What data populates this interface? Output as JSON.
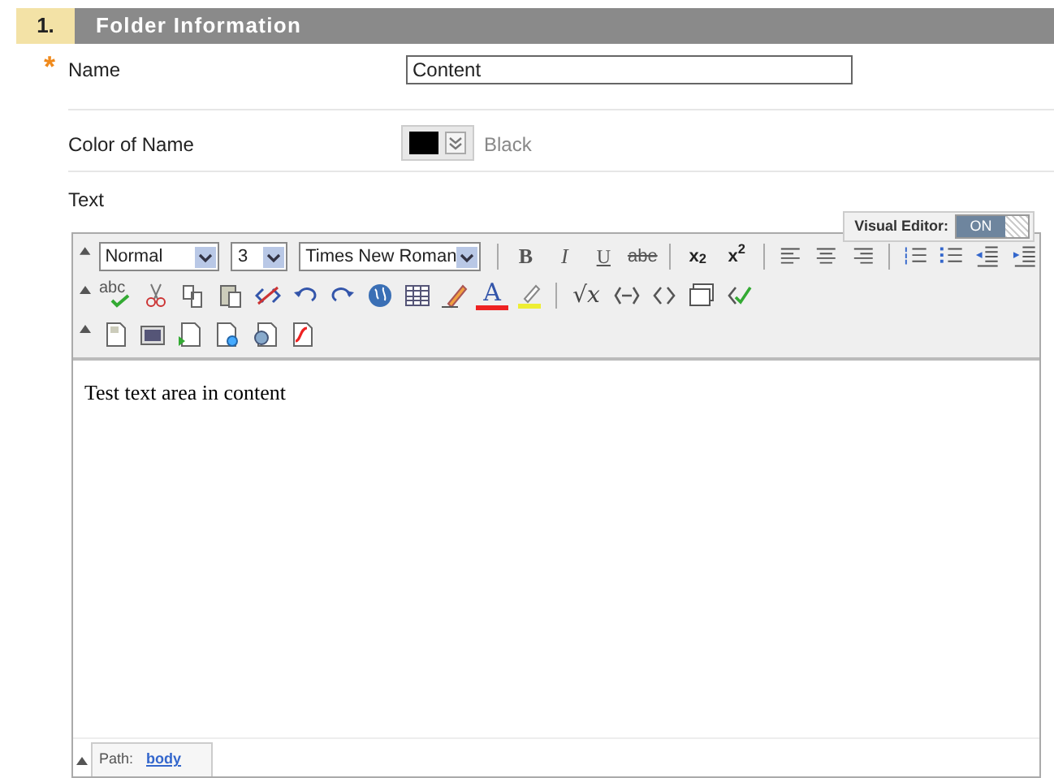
{
  "section": {
    "number": "1.",
    "title": "Folder Information"
  },
  "fields": [
    {
      "kind": "text",
      "label": "Name",
      "required_mark": "*",
      "value": "Content"
    },
    {
      "kind": "color",
      "label": "Color of Name",
      "color": "#000000",
      "color_name": "Black"
    }
  ],
  "text_label": "Text",
  "visual_editor": {
    "label": "Visual Editor:",
    "state": "ON",
    "on": true
  },
  "toolbar": [
    [
      {
        "kind": "select",
        "value": "Normal"
      },
      {
        "kind": "select",
        "value": "3"
      },
      {
        "kind": "select",
        "value": "Times New Roman"
      },
      {
        "kind": "sep"
      },
      {
        "kind": "text",
        "label": "B"
      },
      {
        "kind": "text",
        "label": "I"
      },
      {
        "kind": "text",
        "label": "U"
      },
      {
        "kind": "text",
        "label": "abe"
      },
      {
        "kind": "sep"
      },
      {
        "kind": "text",
        "label": "x$_{2}$"
      },
      {
        "kind": "text",
        "label": "x$^{2}$"
      },
      {
        "kind": "sep"
      },
      {
        "kind": "icon"
      },
      {
        "kind": "icon"
      },
      {
        "kind": "icon"
      },
      {
        "kind": "sep"
      },
      {
        "kind": "icon"
      },
      {
        "kind": "icon"
      },
      {
        "kind": "icon"
      },
      {
        "kind": "icon"
      }
    ],
    [
      {
        "kind": "spell",
        "label": "abc"
      },
      {
        "kind": "icon"
      },
      {
        "kind": "icon"
      },
      {
        "kind": "icon"
      },
      {
        "kind": "icon"
      },
      {
        "kind": "icon"
      },
      {
        "kind": "icon"
      },
      {
        "kind": "icon"
      },
      {
        "kind": "icon"
      },
      {
        "kind": "icon"
      },
      {
        "kind": "fontcolor",
        "label": "A"
      },
      {
        "kind": "icon"
      },
      {
        "kind": "sep"
      },
      {
        "kind": "math",
        "label": "√x"
      },
      {
        "kind": "icon"
      },
      {
        "kind": "icon"
      },
      {
        "kind": "icon"
      },
      {
        "kind": "icon"
      }
    ],
    [
      {
        "kind": "icon"
      },
      {
        "kind": "icon"
      },
      {
        "kind": "icon"
      },
      {
        "kind": "icon"
      },
      {
        "kind": "icon"
      },
      {
        "kind": "icon"
      }
    ]
  ],
  "content": "Test text area in content",
  "path": {
    "label": "Path:",
    "link": "body"
  }
}
